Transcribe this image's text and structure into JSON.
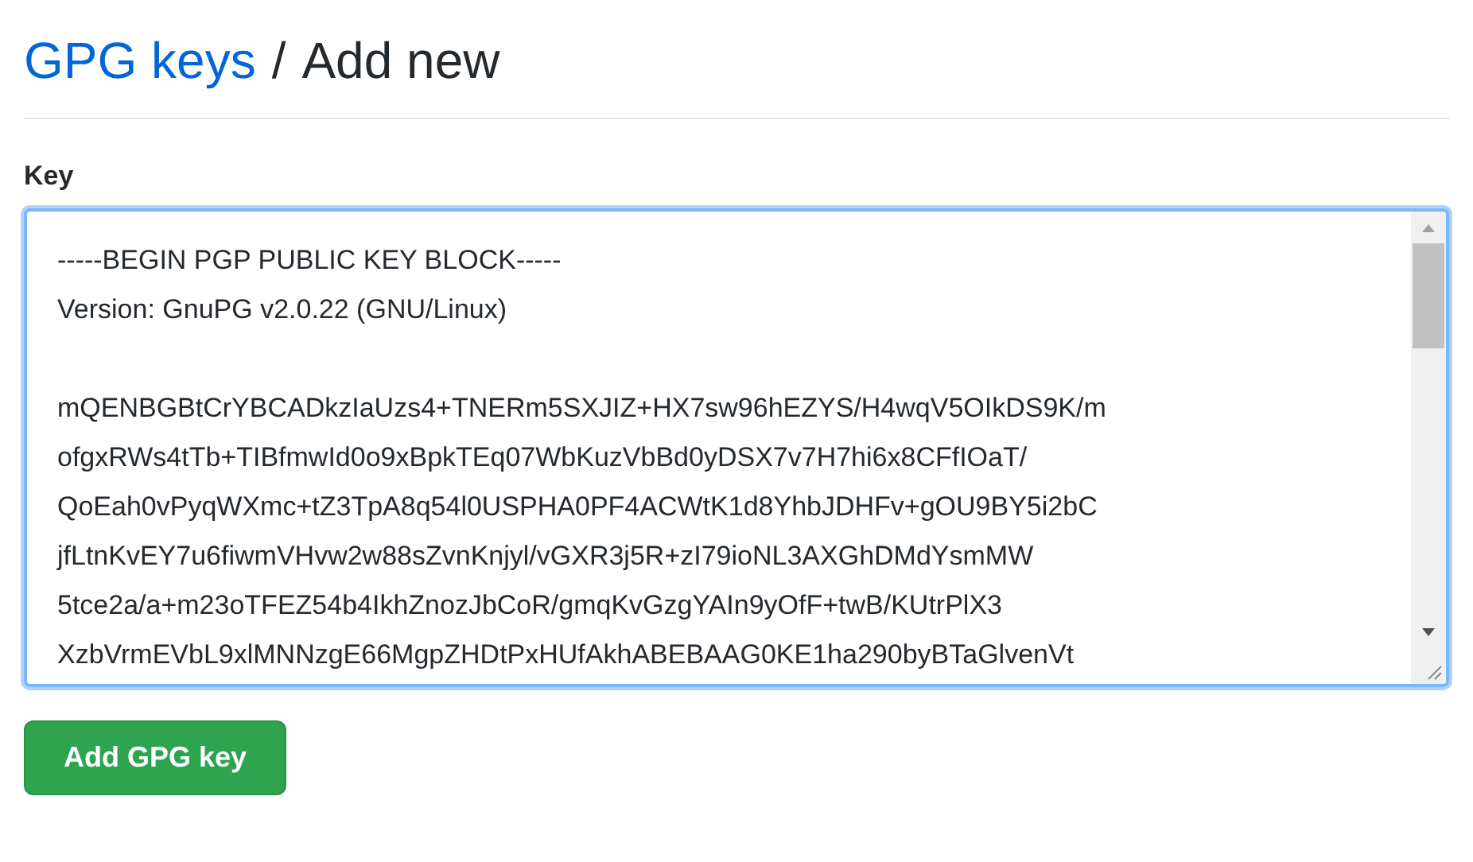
{
  "header": {
    "link": "GPG keys",
    "separator": "/",
    "title": "Add new"
  },
  "form": {
    "label": "Key",
    "value": "-----BEGIN PGP PUBLIC KEY BLOCK-----\nVersion: GnuPG v2.0.22 (GNU/Linux)\n\nmQENBGBtCrYBCADkzIaUzs4+TNERm5SXJIZ+HX7sw96hEZYS/H4wqV5OIkDS9K/m\nofgxRWs4tTb+TIBfmwId0o9xBpkTEq07WbKuzVbBd0yDSX7v7H7hi6x8CFfIOaT/\nQoEah0vPyqWXmc+tZ3TpA8q54l0USPHA0PF4ACWtK1d8YhbJDHFv+gOU9BY5i2bC\njfLtnKvEY7u6fiwmVHvw2w88sZvnKnjyl/vGXR3j5R+zI79ioNL3AXGhDMdYsmMW\n5tce2a/a+m23oTFEZ54b4IkhZnozJbCoR/gmqKvGzgYAIn9yOfF+twB/KUtrPlX3\nXzbVrmEVbL9xlMNNzgE66MgpZHDtPxHUfAkhABEBAAG0KE1ha290byBTaGlvenVt",
    "focused": true,
    "button": "Add GPG key"
  }
}
